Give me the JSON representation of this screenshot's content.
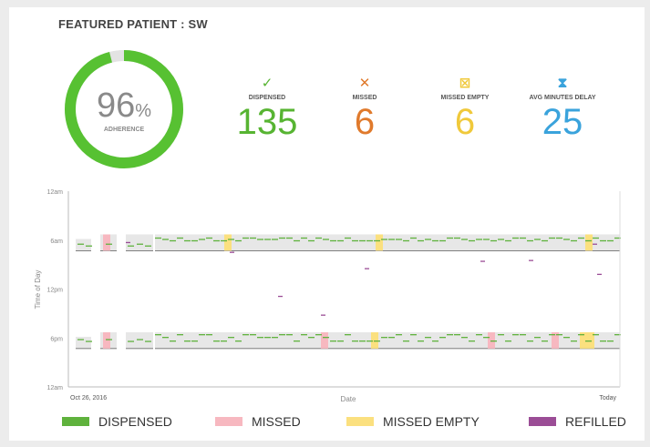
{
  "header": {
    "title": "FEATURED PATIENT : SW"
  },
  "adherence": {
    "value": "96",
    "unit": "%",
    "label": "ADHERENCE",
    "fraction": 0.96,
    "color": "#57c132"
  },
  "stats": [
    {
      "icon": "✓",
      "label": "DISPENSED",
      "value": "135"
    },
    {
      "icon": "✕",
      "label": "MISSED",
      "value": "6"
    },
    {
      "icon": "⊠",
      "label": "MISSED EMPTY",
      "value": "6"
    },
    {
      "icon": "⧗",
      "label": "AVG MINUTES DELAY",
      "value": "25"
    }
  ],
  "chart_data": {
    "type": "scatter",
    "xlabel": "Date",
    "ylabel": "Time of Day",
    "x_tick_labels": [
      "Oct 26, 2016",
      "Today"
    ],
    "y_tick_labels": [
      "12am",
      "6am",
      "12pm",
      "6pm",
      "12am"
    ],
    "ylim_hours": [
      0,
      24
    ],
    "x_range": [
      "Oct 26, 2016",
      "Today"
    ],
    "grid": false,
    "legend_position": "bottom",
    "colors": {
      "dispensed": "#5fb23d",
      "missed": "#f7b8c0",
      "missed_empty": "#fbe07f",
      "refilled": "#9b4d96",
      "window": "#e7e7e7"
    }
  },
  "legend": [
    {
      "label": "DISPENSED",
      "color": "#5fb23d"
    },
    {
      "label": "MISSED",
      "color": "#f7b8c0"
    },
    {
      "label": "MISSED EMPTY",
      "color": "#fbe07f"
    },
    {
      "label": "REFILLED",
      "color": "#9b4d96"
    }
  ]
}
